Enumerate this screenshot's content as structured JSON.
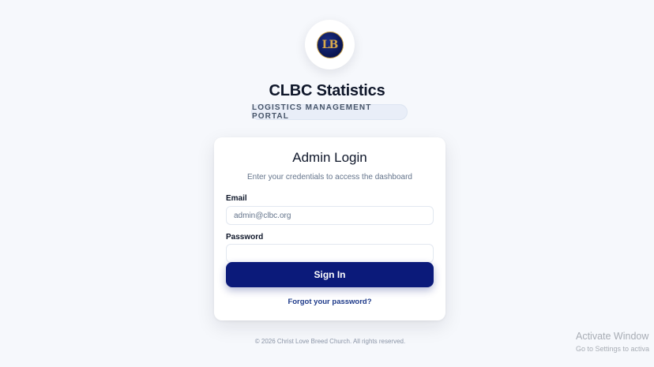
{
  "brand": {
    "logo_text": "LB",
    "app_title": "CLBC Statistics",
    "subtitle": "LOGISTICS MANAGEMENT PORTAL"
  },
  "login": {
    "title": "Admin Login",
    "description": "Enter your credentials to access the dashboard",
    "email_label": "Email",
    "email_placeholder": "admin@clbc.org",
    "email_value": "",
    "password_label": "Password",
    "password_value": "",
    "submit_label": "Sign In",
    "forgot_label": "Forgot your password?"
  },
  "footer": {
    "copyright": "© 2026 Christ Love Breed Church. All rights reserved."
  },
  "os_watermark": {
    "title": "Activate Window",
    "subtitle": "Go to Settings to activa"
  },
  "colors": {
    "background": "#f6f8fc",
    "primary": "#0b1a7a",
    "link": "#1e3a8a",
    "logo_navy": "#0a1550",
    "logo_gold": "#d9a94a"
  }
}
